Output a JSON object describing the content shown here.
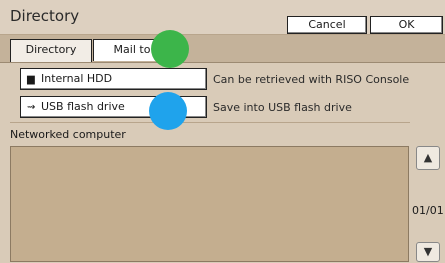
{
  "window": {
    "title": "Directory"
  },
  "actions": {
    "cancel": "Cancel",
    "ok": "OK"
  },
  "tabs": [
    {
      "label": "Directory",
      "selected": true
    },
    {
      "label": "Mail to",
      "selected": false
    }
  ],
  "destinations": [
    {
      "label": "Internal HDD",
      "icon": "hdd-icon",
      "description": "Can be retrieved with RISO Console"
    },
    {
      "label": "USB flash drive",
      "icon": "usb-icon",
      "description": "Save into USB flash drive"
    }
  ],
  "networked": {
    "label": "Networked computer",
    "page": "01/01"
  },
  "markers": {
    "green": "#3cb54a",
    "blue": "#1fa3ec"
  }
}
